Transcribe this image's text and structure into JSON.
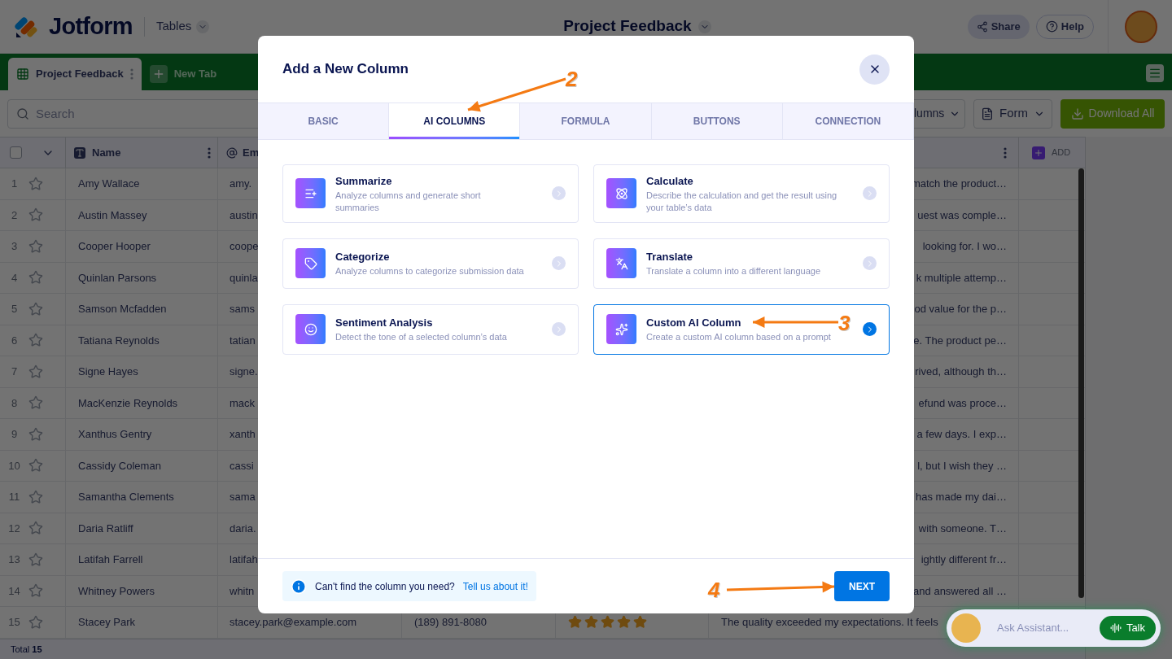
{
  "header": {
    "logo": "Jotform",
    "section": "Tables",
    "title": "Project Feedback",
    "share": "Share",
    "help": "Help"
  },
  "tabs": [
    {
      "label": "Project Feedback",
      "selected": true
    }
  ],
  "new_tab": "New Tab",
  "toolbar": {
    "search_placeholder": "Search",
    "columns": "lumns",
    "form": "Form",
    "download": "Download All"
  },
  "table": {
    "select_all": {
      "checked": false
    },
    "columns": [
      {
        "label": "Name"
      },
      {
        "label": "Em"
      }
    ],
    "add": "ADD",
    "rows": [
      {
        "number": "1",
        "starred": false,
        "name": "Amy Wallace",
        "email": "amy.",
        "review": "match the product…"
      },
      {
        "number": "2",
        "starred": false,
        "name": "Austin Massey",
        "email": "austin",
        "review": "uest was comple…"
      },
      {
        "number": "3",
        "starred": false,
        "name": "Cooper Hooper",
        "email": "coope",
        "review": "looking for. I wo…"
      },
      {
        "number": "4",
        "starred": false,
        "name": "Quinlan Parsons",
        "email": "quinla",
        "review": "k multiple attemp…"
      },
      {
        "number": "5",
        "starred": false,
        "name": "Samson Mcfadden",
        "email": "sams",
        "review": "od value for the p…"
      },
      {
        "number": "6",
        "starred": false,
        "name": "Tatiana Reynolds",
        "email": "tatian",
        "review": "e. The product pe…"
      },
      {
        "number": "7",
        "starred": false,
        "name": "Signe Hayes",
        "email": "signe.",
        "review": "rived, although th…"
      },
      {
        "number": "8",
        "starred": false,
        "name": "MacKenzie Reynolds",
        "email": "mack",
        "review": "efund was proce…"
      },
      {
        "number": "9",
        "starred": false,
        "name": "Xanthus Gentry",
        "email": "xanth",
        "review": "a few days. I exp…"
      },
      {
        "number": "10",
        "starred": false,
        "name": "Cassidy Coleman",
        "email": "cassi",
        "review": "l, but I wish they …"
      },
      {
        "number": "11",
        "starred": false,
        "name": "Samantha Clements",
        "email": "sama",
        "review": "has made my dai…"
      },
      {
        "number": "12",
        "starred": false,
        "name": "Daria Ratliff",
        "email": "daria.",
        "review": "with someone. T…"
      },
      {
        "number": "13",
        "starred": false,
        "name": "Latifah Farrell",
        "email": "latifah",
        "review": "ightly different fr…"
      },
      {
        "number": "14",
        "starred": false,
        "name": "Whitney Powers",
        "email": "whitn",
        "review": "and answered all …"
      },
      {
        "number": "15",
        "starred": false,
        "name": "Stacey Park",
        "email": "stacey.park@example.com",
        "phone": "(189) 891-8080",
        "stars": 5,
        "review": "The quality exceeded my expectations. It feels"
      }
    ],
    "total_label": "Total",
    "total": "15"
  },
  "modal": {
    "title": "Add a New Column",
    "tabs": [
      {
        "label": "BASIC",
        "selected": false
      },
      {
        "label": "AI COLUMNS",
        "selected": true
      },
      {
        "label": "FORMULA",
        "selected": false
      },
      {
        "label": "BUTTONS",
        "selected": false
      },
      {
        "label": "CONNECTION",
        "selected": false
      }
    ],
    "options": [
      {
        "title": "Summarize",
        "description": "Analyze columns and generate short summaries",
        "selected": false
      },
      {
        "title": "Calculate",
        "description": "Describe the calculation and get the result using your table’s data",
        "selected": false
      },
      {
        "title": "Categorize",
        "description": "Analyze columns to categorize submission data",
        "selected": false
      },
      {
        "title": "Translate",
        "description": "Translate a column into a different language",
        "selected": false
      },
      {
        "title": "Sentiment Analysis",
        "description": "Detect the tone of a selected column’s data",
        "selected": false
      },
      {
        "title": "Custom AI Column",
        "description": "Create a custom AI column based on a prompt",
        "selected": true
      }
    ],
    "info": "Can't find the column you need?",
    "link": "Tell us about it!",
    "next": "NEXT"
  },
  "annotations": [
    {
      "label": "2"
    },
    {
      "label": "3"
    },
    {
      "label": "4"
    }
  ],
  "assistant": {
    "placeholder": "Ask Assistant...",
    "talk": "Talk"
  }
}
